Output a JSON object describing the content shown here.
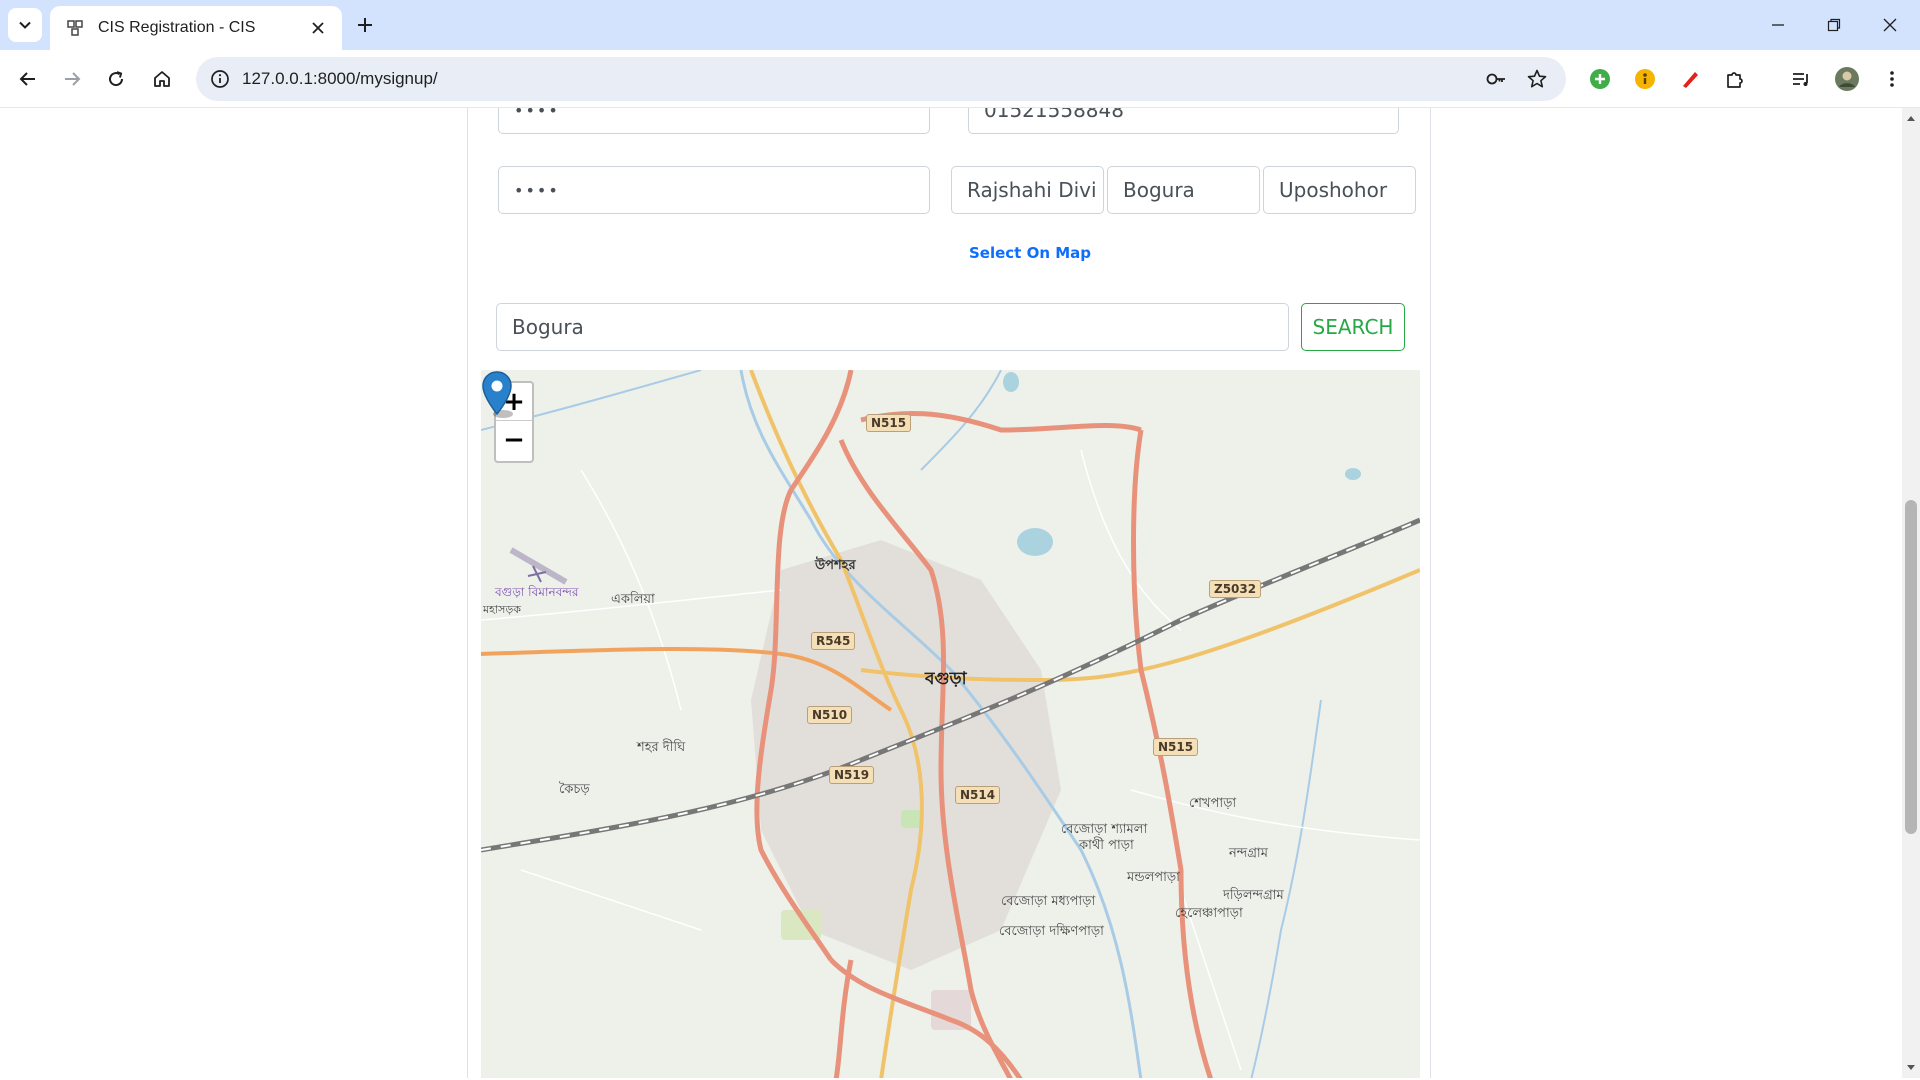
{
  "browser": {
    "tab_title": "CIS Registration - CIS",
    "url": "127.0.0.1:8000/mysignup/"
  },
  "form": {
    "password_mask": "••••",
    "confirm_password_mask": "••••",
    "phone": "01521558848",
    "division": "Rajshahi Divi",
    "district": "Bogura",
    "upazila": "Uposhohor",
    "select_on_map": "Select On Map"
  },
  "search": {
    "value": "Bogura",
    "button_label": "SEARCH"
  },
  "map": {
    "zoom_in": "+",
    "zoom_out": "−",
    "labels": {
      "city": "বগুড়া",
      "uposhohor": "উপশহর",
      "airport": "বগুড়া বিমানবন্দর",
      "ekoliya": "একলিয়া",
      "shohor_dighi": "শহর দীঘি",
      "kaichor": "কৈচড়",
      "shekhpara": "শেখপাড়া",
      "bejora_shamla": "বেজোড়া শ্যামলা",
      "kathi_para": "কাথী পাড়া",
      "nondogram": "নন্দগ্রাম",
      "mondolpara": "মন্ডলপাড়া",
      "dolindogram": "দড়িলন্দগ্রাম",
      "helenkapara": "হেলেঞ্চাপাড়া",
      "bejora_moddhopara": "বেজোড়া মধ্যপাড়া",
      "bejora_dokkhinpara": "বেজোড়া দক্ষিণপাড়া",
      "mohasorok": "মহাসড়ক"
    },
    "road_shields": {
      "n515_top": "N515",
      "n515_right": "N515",
      "z5032": "Z5032",
      "r545": "R545",
      "n510": "N510",
      "n519": "N519",
      "n514": "N514"
    }
  },
  "colors": {
    "link": "#0d6efd",
    "success": "#28a745",
    "marker": "#2a81cb",
    "primary_road": "#e8927c",
    "secondary_road": "#f0c36a"
  }
}
